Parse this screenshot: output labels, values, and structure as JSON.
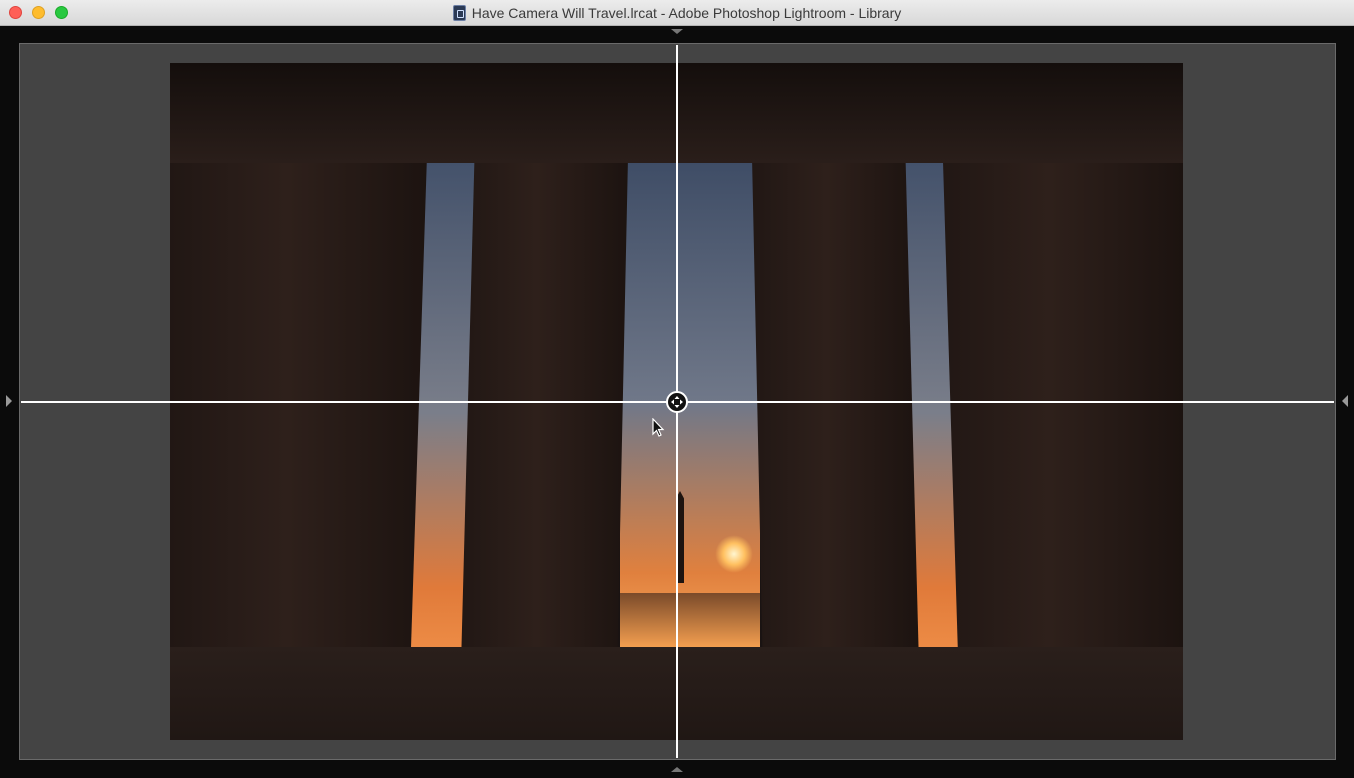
{
  "window": {
    "title": "Have Camera Will Travel.lrcat - Adobe Photoshop Lightroom - Library",
    "doc_icon": "lightroom-catalog-icon"
  },
  "traffic_lights": {
    "close_color": "#fe5f57",
    "minimize_color": "#febc2e",
    "maximize_color": "#28c840"
  },
  "loupe": {
    "background": "#444444",
    "photo_alt": "Silhouetted columns of the Lincoln Memorial framing the Washington Monument and reflecting pool at sunrise",
    "guides": {
      "color": "#ffffff",
      "center_handle_icon": "move-crosshair-icon"
    }
  },
  "panel_toggles": {
    "left": "collapse-left-panel-arrow-icon",
    "right": "collapse-right-panel-arrow-icon",
    "top": "collapse-top-panel-arrow-icon",
    "bottom": "collapse-bottom-panel-arrow-icon"
  },
  "cursor": "arrow-pointer-icon"
}
